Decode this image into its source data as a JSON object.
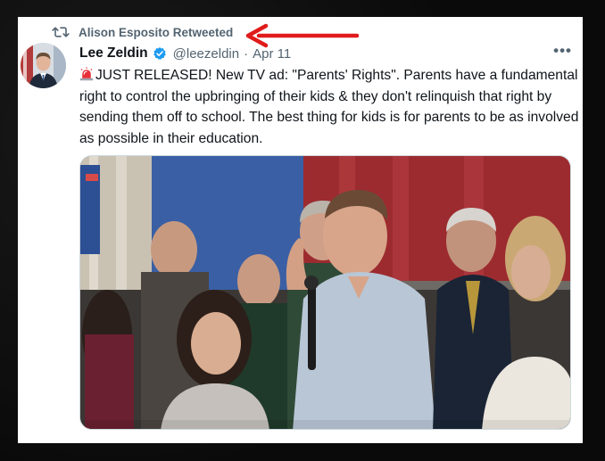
{
  "retweet": {
    "icon": "retweet-icon",
    "label": "Alison Esposito Retweeted"
  },
  "annotation": {
    "icon": "red-arrow-icon",
    "color": "#e01b1b"
  },
  "tweet": {
    "author_name": "Lee Zeldin",
    "verified_icon": "verified-badge-icon",
    "handle": "@leezeldin",
    "separator": "·",
    "date": "Apr 11",
    "more_label": "•••",
    "emoji": "siren-icon",
    "text": "JUST RELEASED! New TV ad: \"Parents' Rights\". Parents have a fundamental right to control the upbringing of their kids & they don't relinquish that right by sending them off to school. The best thing for kids is for parents to be as involved as possible in their education."
  },
  "colors": {
    "primary_text": "#0f1419",
    "secondary_text": "#536471",
    "verified": "#1d9bf0",
    "background_frame": "#0a0a0a"
  }
}
